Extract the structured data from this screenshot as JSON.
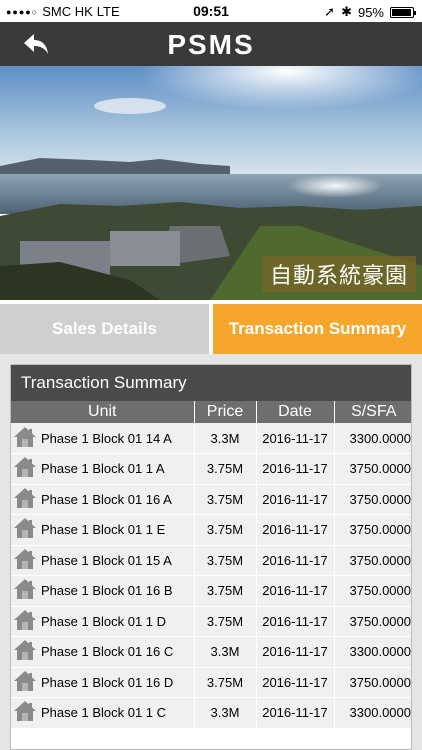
{
  "status": {
    "carrier": "SMC HK",
    "network": "LTE",
    "time": "09:51",
    "battery": "95%",
    "battery_level": 0.95
  },
  "nav": {
    "title": "PSMS"
  },
  "hero": {
    "caption": "自動系統豪園"
  },
  "tabs": [
    {
      "label": "Sales Details",
      "active": false
    },
    {
      "label": "Transaction Summary",
      "active": true
    }
  ],
  "summary": {
    "title": "Transaction Summary",
    "columns": [
      "Unit",
      "Price",
      "Date",
      "S/SFA"
    ],
    "rows": [
      {
        "unit": "Phase 1 Block 01 14 A",
        "price": "3.3M",
        "date": "2016-11-17",
        "ssfa": "3300.0000"
      },
      {
        "unit": "Phase 1 Block 01 1 A",
        "price": "3.75M",
        "date": "2016-11-17",
        "ssfa": "3750.0000"
      },
      {
        "unit": "Phase 1 Block 01 16 A",
        "price": "3.75M",
        "date": "2016-11-17",
        "ssfa": "3750.0000"
      },
      {
        "unit": "Phase 1 Block 01 1 E",
        "price": "3.75M",
        "date": "2016-11-17",
        "ssfa": "3750.0000"
      },
      {
        "unit": "Phase 1 Block 01 15 A",
        "price": "3.75M",
        "date": "2016-11-17",
        "ssfa": "3750.0000"
      },
      {
        "unit": "Phase 1 Block 01 16 B",
        "price": "3.75M",
        "date": "2016-11-17",
        "ssfa": "3750.0000"
      },
      {
        "unit": "Phase 1 Block 01 1 D",
        "price": "3.75M",
        "date": "2016-11-17",
        "ssfa": "3750.0000"
      },
      {
        "unit": "Phase 1 Block 01 16 C",
        "price": "3.3M",
        "date": "2016-11-17",
        "ssfa": "3300.0000"
      },
      {
        "unit": "Phase 1 Block 01 16 D",
        "price": "3.75M",
        "date": "2016-11-17",
        "ssfa": "3750.0000"
      },
      {
        "unit": "Phase 1 Block 01 1 C",
        "price": "3.3M",
        "date": "2016-11-17",
        "ssfa": "3300.0000"
      }
    ]
  },
  "colors": {
    "nav": "#3a3a3a",
    "accent": "#f6a62a",
    "tab_inactive": "#cfcfcf",
    "header": "#4a4a4a"
  },
  "icons": {
    "back": "back-arrow-icon",
    "row": "house-icon"
  }
}
